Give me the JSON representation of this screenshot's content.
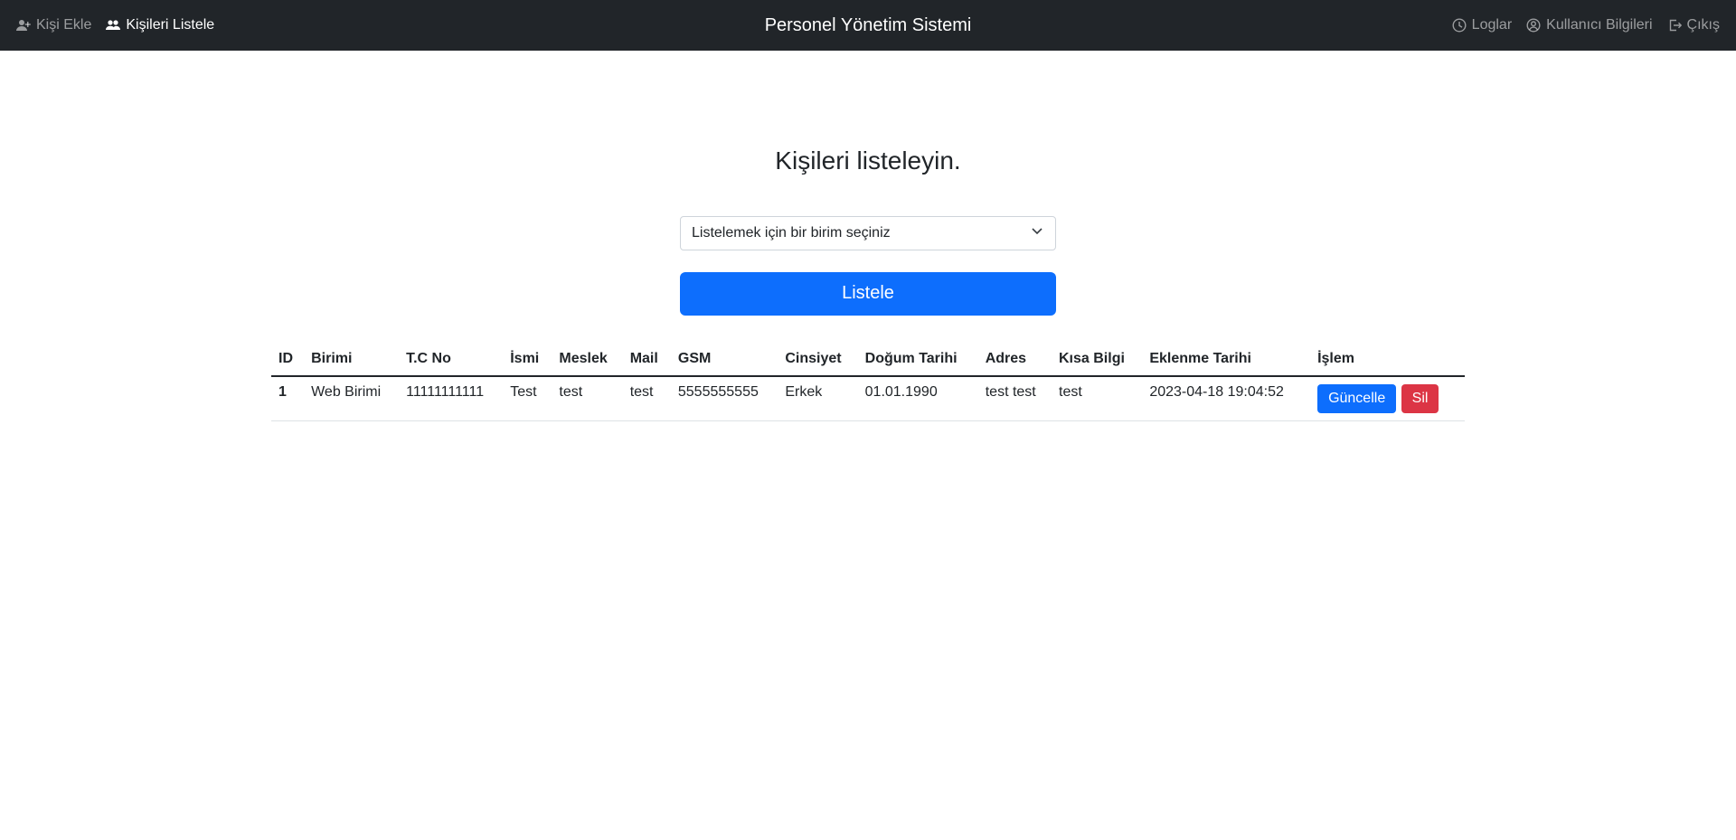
{
  "nav": {
    "brand": "Personel Yönetim Sistemi",
    "left_items": [
      {
        "label": "Kişi Ekle",
        "icon": "user-plus-icon",
        "active": false
      },
      {
        "label": "Kişileri Listele",
        "icon": "users-icon",
        "active": true
      }
    ],
    "right_items": [
      {
        "label": "Loglar",
        "icon": "clock-icon"
      },
      {
        "label": "Kullanıcı Bilgileri",
        "icon": "user-circle-icon"
      },
      {
        "label": "Çıkış",
        "icon": "logout-icon"
      }
    ]
  },
  "main": {
    "title": "Kişileri listeleyin.",
    "select_placeholder": "Listelemek için bir birim seçiniz",
    "list_button": "Listele"
  },
  "table": {
    "headers": [
      "ID",
      "Birimi",
      "T.C No",
      "İsmi",
      "Meslek",
      "Mail",
      "GSM",
      "Cinsiyet",
      "Doğum Tarihi",
      "Adres",
      "Kısa Bilgi",
      "Eklenme Tarihi",
      "İşlem"
    ],
    "rows": [
      {
        "id": "1",
        "birimi": "Web Birimi",
        "tc": "11111111111",
        "isim": "Test",
        "meslek": "test",
        "mail": "test",
        "gsm": "5555555555",
        "cinsiyet": "Erkek",
        "dogum": "01.01.1990",
        "adres": "test test",
        "bilgi": "test",
        "eklenme": "2023-04-18 19:04:52",
        "update_label": "Güncelle",
        "delete_label": "Sil"
      }
    ]
  },
  "colors": {
    "navbar": "#212529",
    "primary": "#0d6efd",
    "danger": "#dc3545"
  }
}
